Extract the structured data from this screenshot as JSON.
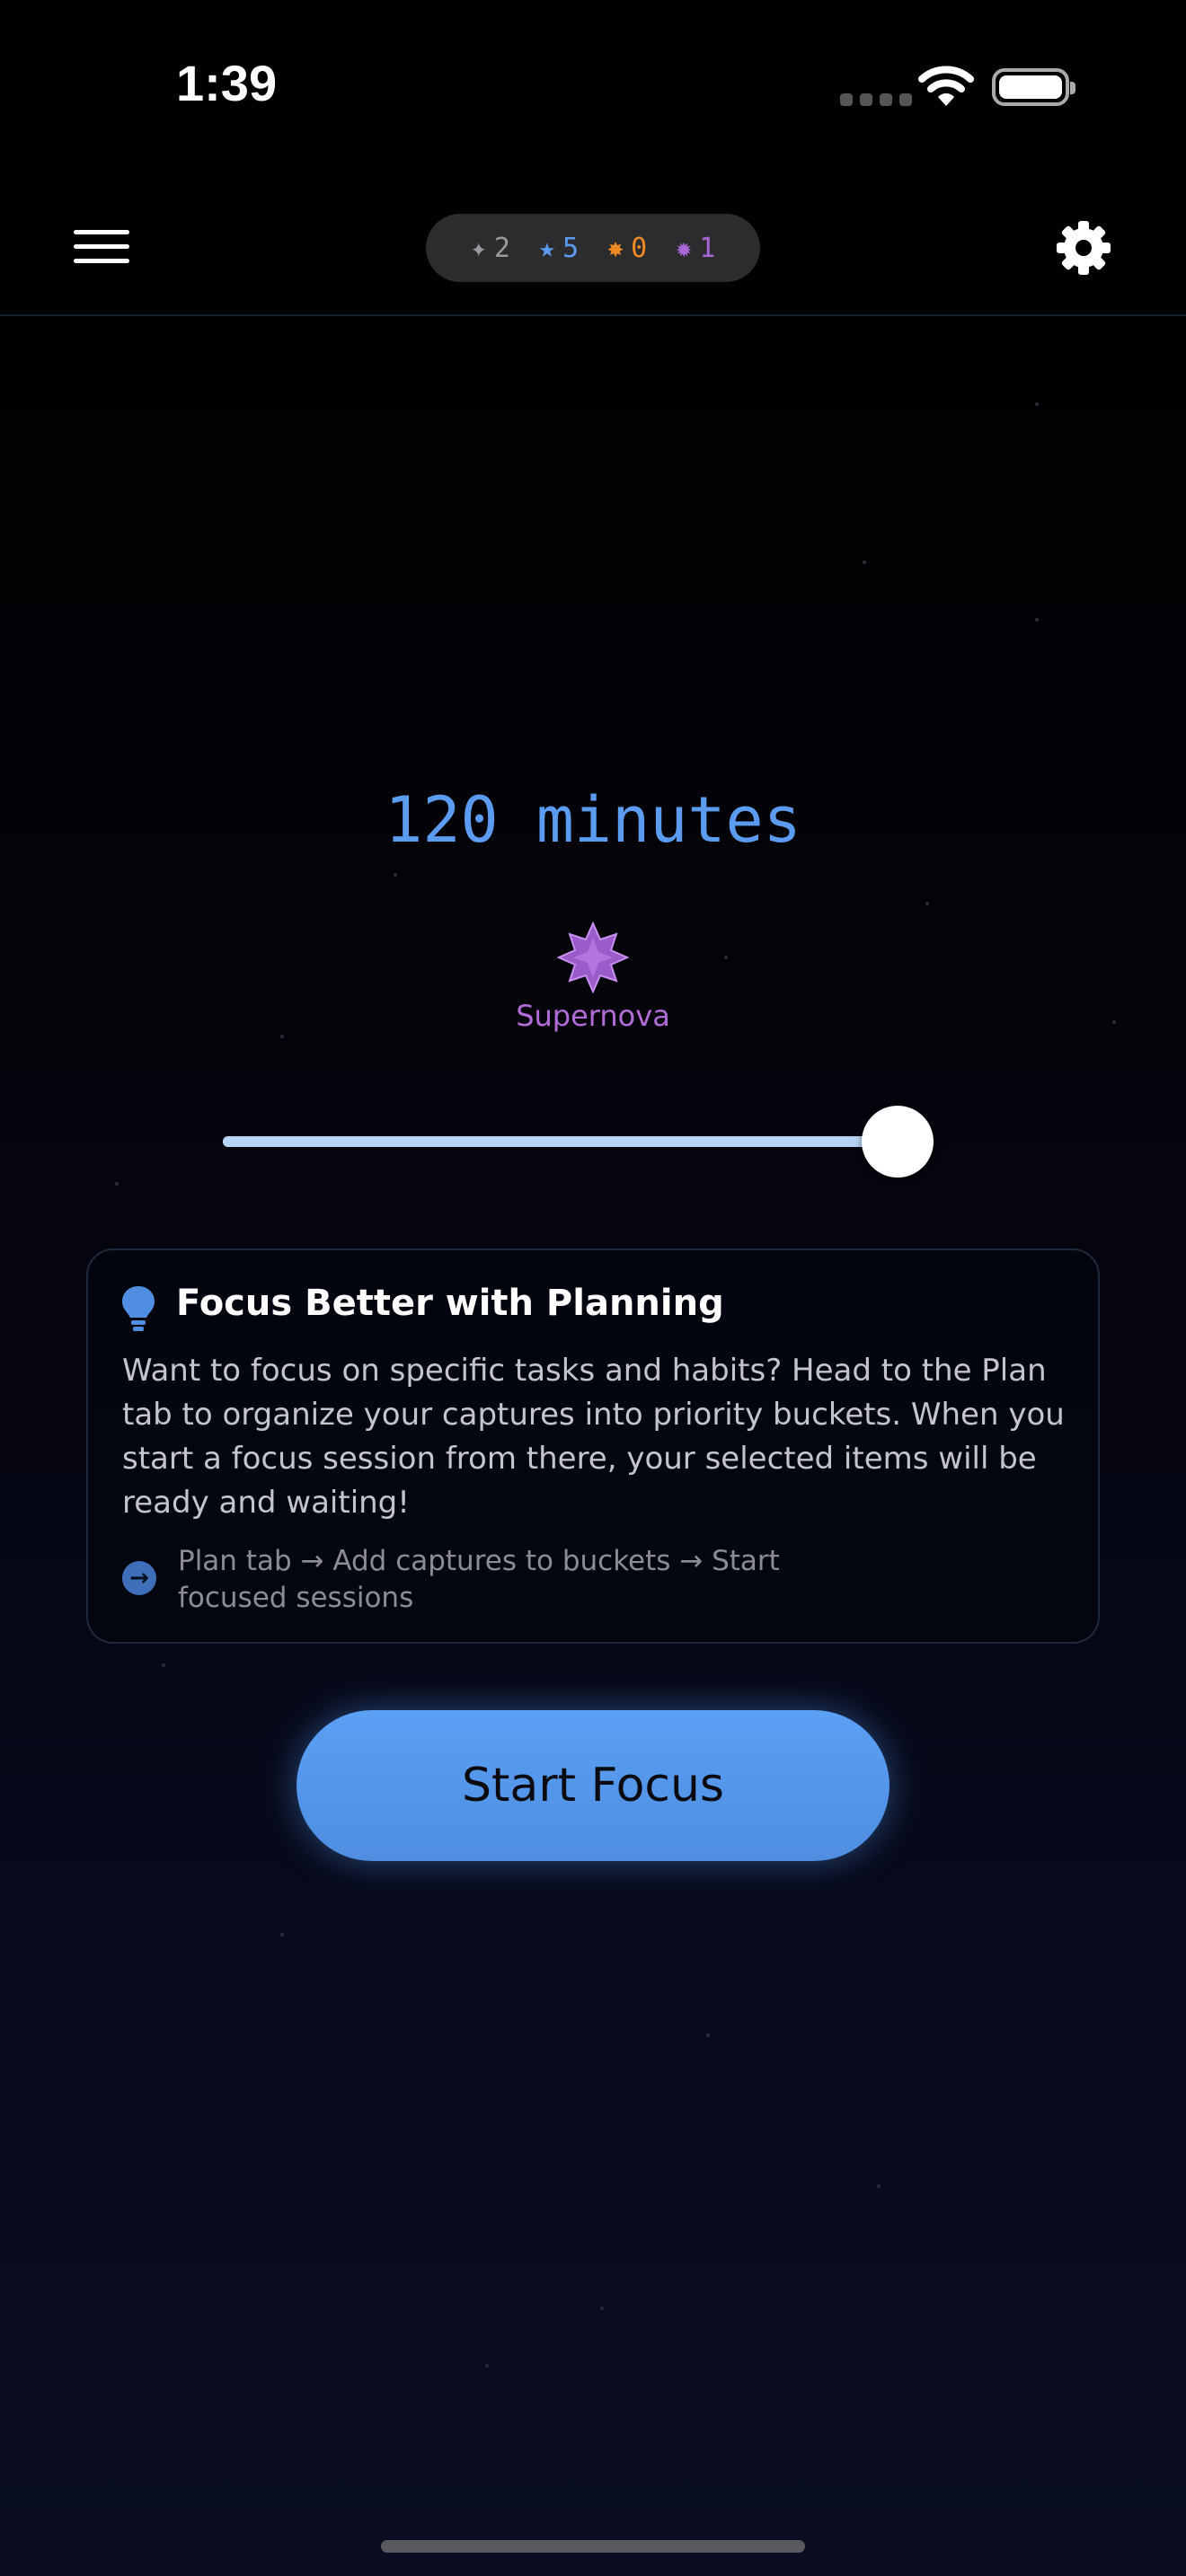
{
  "status_bar": {
    "time": "1:39"
  },
  "header": {
    "counters": [
      {
        "icon": "sparkle-icon",
        "symbol": "✦",
        "value": "2",
        "color": "#9a9a9e"
      },
      {
        "icon": "star-icon",
        "symbol": "★",
        "value": "5",
        "color": "#5b9bf0"
      },
      {
        "icon": "sun-icon",
        "symbol": "✸",
        "value": "0",
        "color": "#f08a24"
      },
      {
        "icon": "supernova-icon",
        "symbol": "✹",
        "value": "1",
        "color": "#a866d6"
      }
    ]
  },
  "focus": {
    "duration_label": "120 minutes",
    "level_name": "Supernova",
    "slider_fraction": 0.95
  },
  "tip": {
    "title": "Focus Better with Planning",
    "body": "Want to focus on specific tasks and habits? Head to the Plan tab to organize your captures into priority buckets. When you start a focus session from there, your selected items will be ready and waiting!",
    "steps": "Plan tab → Add captures to buckets → Start focused sessions",
    "arrow": "→"
  },
  "start_button": {
    "label": "Start Focus"
  },
  "colors": {
    "accent": "#5b9bf0",
    "supernova": "#b26cd8"
  }
}
